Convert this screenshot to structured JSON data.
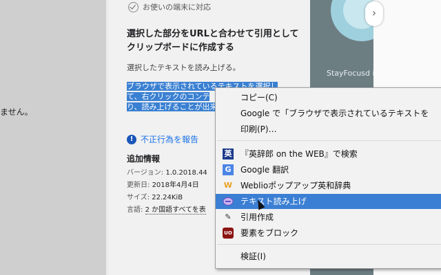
{
  "left": {
    "partial_text": "ません。"
  },
  "detail": {
    "device_support": "お使いの端末に対応",
    "heading": "選択した部分をURLと合わせて引用としてクリップボードに作成する",
    "description": "選択したテキストを読み上げる。",
    "selected_lines": [
      "ブラウザで表示されているテキストを選択し",
      "て、右クリックのコンテ",
      "り、読み上げることが出来"
    ],
    "report_abuse": "不正行為を報告",
    "additional_info_title": "追加情報",
    "info": [
      {
        "label": "バージョン: ",
        "value": "1.0.2018.44"
      },
      {
        "label": "更新日: ",
        "value": "2018年4月4日"
      },
      {
        "label": "サイズ: ",
        "value": "22.24KiB"
      },
      {
        "label": "言語: ",
        "value": "2 か国語すべてを表"
      }
    ]
  },
  "promo": {
    "text": "StayFocusd in"
  },
  "next_button": {
    "glyph": "›"
  },
  "context_menu": {
    "items": [
      {
        "label": "コピー(C)",
        "icon": ""
      },
      {
        "label": "Google で「ブラウザで表示されているテキストを",
        "icon": ""
      },
      {
        "label": "印刷(P)…",
        "icon": ""
      },
      {
        "label": "『英辞郎 on the WEB』で検索",
        "icon": "eijiro-icon"
      },
      {
        "label": "Google 翻訳",
        "icon": "google-translate-icon"
      },
      {
        "label": "Weblioポップアップ英和辞典",
        "icon": "weblio-icon"
      },
      {
        "label": "テキスト読み上げ",
        "icon": "text-to-speech-icon"
      },
      {
        "label": "引用作成",
        "icon": "quote-icon"
      },
      {
        "label": "要素をブロック",
        "icon": "ublock-icon"
      },
      {
        "label": "検証(I)",
        "icon": ""
      }
    ],
    "icon_glyphs": {
      "eijiro": "英",
      "google_translate": "G",
      "weblio": "W",
      "quote": "✎",
      "ublock": "UO"
    }
  },
  "colors": {
    "highlight": "#3b7fd4",
    "selection": "#3a80d2",
    "link": "#1a73e8"
  }
}
